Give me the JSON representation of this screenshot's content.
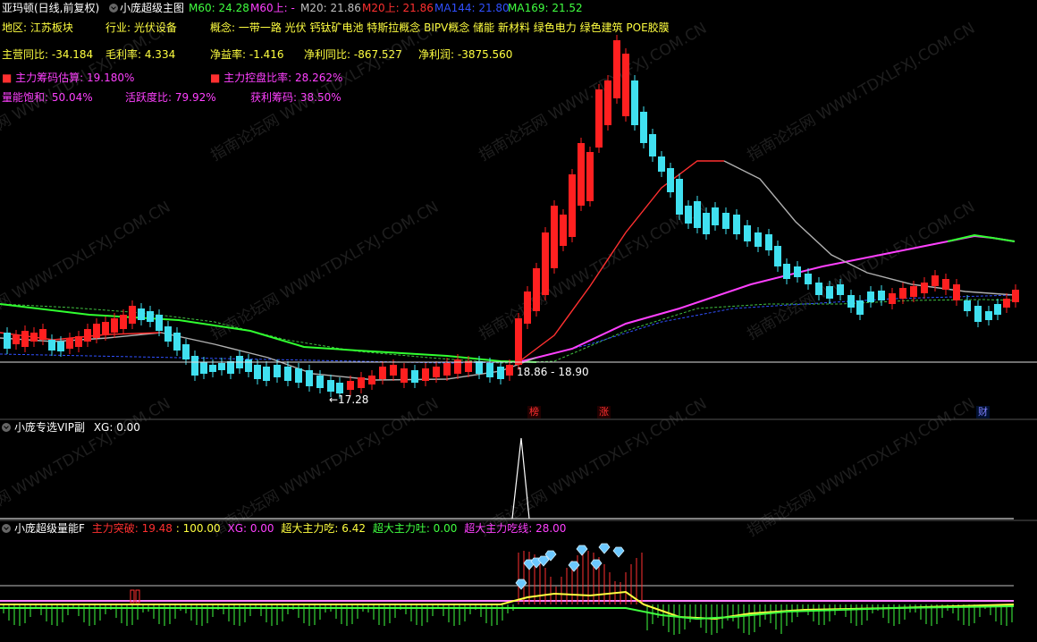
{
  "title_bar": {
    "stock_name": "亚玛顿(日线,前复权)",
    "indicator_name": "小庞超级主图",
    "ma_items": [
      {
        "label": "M60: 24.28",
        "color": "#40ff40"
      },
      {
        "label": "M60上: -",
        "color": "#ff40ff"
      },
      {
        "label": "M20: 21.86",
        "color": "#c0c0c0"
      },
      {
        "label": "M20上: 21.86",
        "color": "#ff3030"
      },
      {
        "label": "MA144: 21.80",
        "color": "#3050ff"
      },
      {
        "label": "MA169: 21.52",
        "color": "#40ff40"
      }
    ]
  },
  "info": {
    "region": "地区: 江苏板块",
    "industry": "行业: 光伏设备",
    "concept": "概念: 一带一路 光伏 钙钛矿电池 特斯拉概念 BIPV概念 储能 新材料 绿色电力 绿色建筑 POE胶膜",
    "revenue_yoy": "主营同比: -34.184",
    "gross_margin": "毛利率: 4.334",
    "net_margin": "净益率: -1.416",
    "net_profit_yoy": "净利同比: -867.527",
    "net_profit": "净利润: -3875.560",
    "main_chip": "主力筹码估算: 19.180%",
    "main_control": "主力控盘比率: 28.262%",
    "vol_sat": "量能饱和: 50.04%",
    "activity": "活跃度比: 79.92%",
    "profit_chip": "获利筹码: 38.50%"
  },
  "price_annotations": {
    "low_label": "←17.28",
    "range_label": "18.86 - 18.90"
  },
  "event_tags": [
    "榜",
    "涨",
    "财"
  ],
  "panel2": {
    "name": "小庞专选VIP副",
    "xg": "XG: 0.00"
  },
  "panel3": {
    "name": "小庞超级量能F",
    "items": [
      {
        "label": "主力突破: 19.48",
        "color": "#ff3030"
      },
      {
        "label": ": 100.00",
        "color": "#ffff40"
      },
      {
        "label": "XG: 0.00",
        "color": "#ff40ff"
      },
      {
        "label": "超大主力吃: 6.42",
        "color": "#ffff40"
      },
      {
        "label": "超大主力吐: 0.00",
        "color": "#40ff40"
      },
      {
        "label": "超大主力吃线: 28.00",
        "color": "#ff40ff"
      }
    ]
  },
  "watermark": "指南论坛网 WWW.TDXLFXJ.COM.CN",
  "colors": {
    "up": "#ff2020",
    "down": "#40e0f0",
    "bg": "#000000"
  }
}
